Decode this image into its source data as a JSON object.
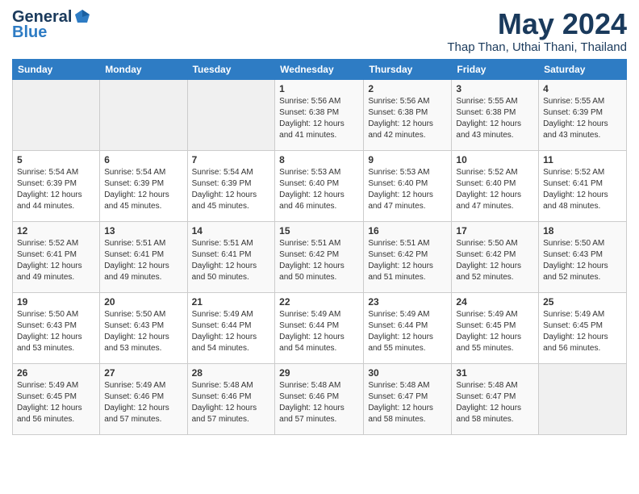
{
  "header": {
    "logo_general": "General",
    "logo_blue": "Blue",
    "month": "May 2024",
    "location": "Thap Than, Uthai Thani, Thailand"
  },
  "weekdays": [
    "Sunday",
    "Monday",
    "Tuesday",
    "Wednesday",
    "Thursday",
    "Friday",
    "Saturday"
  ],
  "weeks": [
    [
      {
        "day": "",
        "content": ""
      },
      {
        "day": "",
        "content": ""
      },
      {
        "day": "",
        "content": ""
      },
      {
        "day": "1",
        "content": "Sunrise: 5:56 AM\nSunset: 6:38 PM\nDaylight: 12 hours\nand 41 minutes."
      },
      {
        "day": "2",
        "content": "Sunrise: 5:56 AM\nSunset: 6:38 PM\nDaylight: 12 hours\nand 42 minutes."
      },
      {
        "day": "3",
        "content": "Sunrise: 5:55 AM\nSunset: 6:38 PM\nDaylight: 12 hours\nand 43 minutes."
      },
      {
        "day": "4",
        "content": "Sunrise: 5:55 AM\nSunset: 6:39 PM\nDaylight: 12 hours\nand 43 minutes."
      }
    ],
    [
      {
        "day": "5",
        "content": "Sunrise: 5:54 AM\nSunset: 6:39 PM\nDaylight: 12 hours\nand 44 minutes."
      },
      {
        "day": "6",
        "content": "Sunrise: 5:54 AM\nSunset: 6:39 PM\nDaylight: 12 hours\nand 45 minutes."
      },
      {
        "day": "7",
        "content": "Sunrise: 5:54 AM\nSunset: 6:39 PM\nDaylight: 12 hours\nand 45 minutes."
      },
      {
        "day": "8",
        "content": "Sunrise: 5:53 AM\nSunset: 6:40 PM\nDaylight: 12 hours\nand 46 minutes."
      },
      {
        "day": "9",
        "content": "Sunrise: 5:53 AM\nSunset: 6:40 PM\nDaylight: 12 hours\nand 47 minutes."
      },
      {
        "day": "10",
        "content": "Sunrise: 5:52 AM\nSunset: 6:40 PM\nDaylight: 12 hours\nand 47 minutes."
      },
      {
        "day": "11",
        "content": "Sunrise: 5:52 AM\nSunset: 6:41 PM\nDaylight: 12 hours\nand 48 minutes."
      }
    ],
    [
      {
        "day": "12",
        "content": "Sunrise: 5:52 AM\nSunset: 6:41 PM\nDaylight: 12 hours\nand 49 minutes."
      },
      {
        "day": "13",
        "content": "Sunrise: 5:51 AM\nSunset: 6:41 PM\nDaylight: 12 hours\nand 49 minutes."
      },
      {
        "day": "14",
        "content": "Sunrise: 5:51 AM\nSunset: 6:41 PM\nDaylight: 12 hours\nand 50 minutes."
      },
      {
        "day": "15",
        "content": "Sunrise: 5:51 AM\nSunset: 6:42 PM\nDaylight: 12 hours\nand 50 minutes."
      },
      {
        "day": "16",
        "content": "Sunrise: 5:51 AM\nSunset: 6:42 PM\nDaylight: 12 hours\nand 51 minutes."
      },
      {
        "day": "17",
        "content": "Sunrise: 5:50 AM\nSunset: 6:42 PM\nDaylight: 12 hours\nand 52 minutes."
      },
      {
        "day": "18",
        "content": "Sunrise: 5:50 AM\nSunset: 6:43 PM\nDaylight: 12 hours\nand 52 minutes."
      }
    ],
    [
      {
        "day": "19",
        "content": "Sunrise: 5:50 AM\nSunset: 6:43 PM\nDaylight: 12 hours\nand 53 minutes."
      },
      {
        "day": "20",
        "content": "Sunrise: 5:50 AM\nSunset: 6:43 PM\nDaylight: 12 hours\nand 53 minutes."
      },
      {
        "day": "21",
        "content": "Sunrise: 5:49 AM\nSunset: 6:44 PM\nDaylight: 12 hours\nand 54 minutes."
      },
      {
        "day": "22",
        "content": "Sunrise: 5:49 AM\nSunset: 6:44 PM\nDaylight: 12 hours\nand 54 minutes."
      },
      {
        "day": "23",
        "content": "Sunrise: 5:49 AM\nSunset: 6:44 PM\nDaylight: 12 hours\nand 55 minutes."
      },
      {
        "day": "24",
        "content": "Sunrise: 5:49 AM\nSunset: 6:45 PM\nDaylight: 12 hours\nand 55 minutes."
      },
      {
        "day": "25",
        "content": "Sunrise: 5:49 AM\nSunset: 6:45 PM\nDaylight: 12 hours\nand 56 minutes."
      }
    ],
    [
      {
        "day": "26",
        "content": "Sunrise: 5:49 AM\nSunset: 6:45 PM\nDaylight: 12 hours\nand 56 minutes."
      },
      {
        "day": "27",
        "content": "Sunrise: 5:49 AM\nSunset: 6:46 PM\nDaylight: 12 hours\nand 57 minutes."
      },
      {
        "day": "28",
        "content": "Sunrise: 5:48 AM\nSunset: 6:46 PM\nDaylight: 12 hours\nand 57 minutes."
      },
      {
        "day": "29",
        "content": "Sunrise: 5:48 AM\nSunset: 6:46 PM\nDaylight: 12 hours\nand 57 minutes."
      },
      {
        "day": "30",
        "content": "Sunrise: 5:48 AM\nSunset: 6:47 PM\nDaylight: 12 hours\nand 58 minutes."
      },
      {
        "day": "31",
        "content": "Sunrise: 5:48 AM\nSunset: 6:47 PM\nDaylight: 12 hours\nand 58 minutes."
      },
      {
        "day": "",
        "content": ""
      }
    ]
  ]
}
